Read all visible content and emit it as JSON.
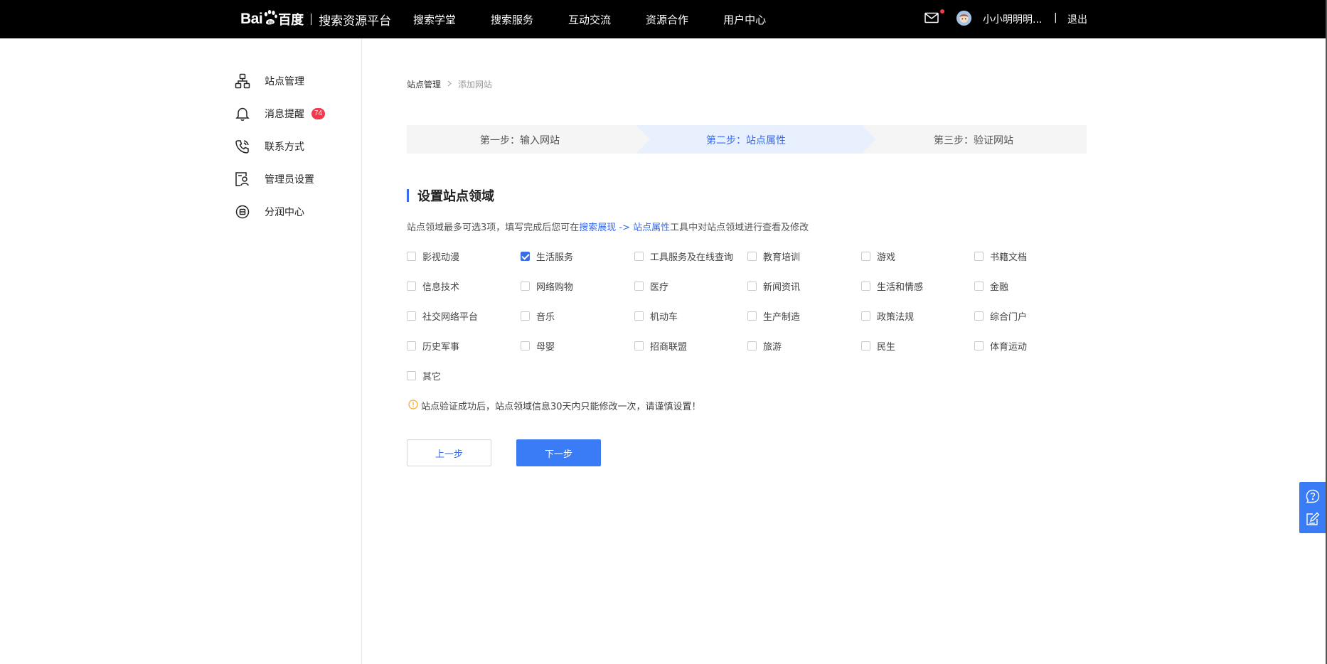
{
  "header": {
    "logo_bai": "Bai",
    "logo_baidu": "百度",
    "platform": "搜索资源平台",
    "nav": [
      "搜索学堂",
      "搜索服务",
      "互动交流",
      "资源合作",
      "用户中心"
    ],
    "user_name": "小小明明明...",
    "separator": "|",
    "logout": "退出"
  },
  "sidebar": {
    "items": [
      {
        "label": "站点管理",
        "icon": "sitemap-icon"
      },
      {
        "label": "消息提醒",
        "icon": "bell-icon",
        "badge": "74"
      },
      {
        "label": "联系方式",
        "icon": "phone-icon"
      },
      {
        "label": "管理员设置",
        "icon": "admin-icon"
      },
      {
        "label": "分润中心",
        "icon": "share-center-icon"
      }
    ]
  },
  "breadcrumb": {
    "parent": "站点管理",
    "current": "添加网站"
  },
  "steps": {
    "items": [
      "第一步：输入网站",
      "第二步：站点属性",
      "第三步：验证网站"
    ],
    "active_index": 1
  },
  "section": {
    "title": "设置站点领域",
    "desc_prefix": "站点领域最多可选3项，填写完成后您可在",
    "desc_link": "搜索展现 -> 站点属性",
    "desc_suffix": "工具中对站点领域进行查看及修改"
  },
  "options": [
    {
      "label": "影视动漫",
      "checked": false
    },
    {
      "label": "生活服务",
      "checked": true
    },
    {
      "label": "工具服务及在线查询",
      "checked": false
    },
    {
      "label": "教育培训",
      "checked": false
    },
    {
      "label": "游戏",
      "checked": false
    },
    {
      "label": "书籍文档",
      "checked": false
    },
    {
      "label": "信息技术",
      "checked": false
    },
    {
      "label": "网络购物",
      "checked": false
    },
    {
      "label": "医疗",
      "checked": false
    },
    {
      "label": "新闻资讯",
      "checked": false
    },
    {
      "label": "生活和情感",
      "checked": false
    },
    {
      "label": "金融",
      "checked": false
    },
    {
      "label": "社交网络平台",
      "checked": false
    },
    {
      "label": "音乐",
      "checked": false
    },
    {
      "label": "机动车",
      "checked": false
    },
    {
      "label": "生产制造",
      "checked": false
    },
    {
      "label": "政策法规",
      "checked": false
    },
    {
      "label": "综合门户",
      "checked": false
    },
    {
      "label": "历史军事",
      "checked": false
    },
    {
      "label": "母婴",
      "checked": false
    },
    {
      "label": "招商联盟",
      "checked": false
    },
    {
      "label": "旅游",
      "checked": false
    },
    {
      "label": "民生",
      "checked": false
    },
    {
      "label": "体育运动",
      "checked": false
    },
    {
      "label": "其它",
      "checked": false
    }
  ],
  "warning": "站点验证成功后，站点领域信息30天内只能修改一次，请谨慎设置！",
  "buttons": {
    "prev": "上一步",
    "next": "下一步"
  },
  "colors": {
    "accent": "#3a6be8",
    "button_primary": "#3a7bf6",
    "badge": "#f2394d",
    "warning": "#f5a623",
    "step_active_bg": "#e8f0fd",
    "step_bg": "#f5f5f5"
  }
}
